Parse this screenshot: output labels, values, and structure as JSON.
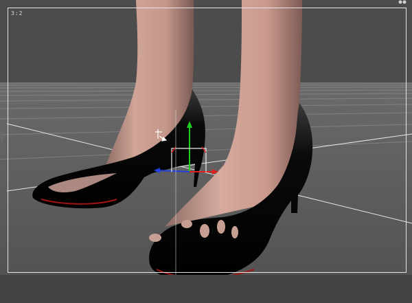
{
  "viewport": {
    "aspect_label": "3:2",
    "frame_color": "#e6e6e6",
    "background_color": "#4c4c4c",
    "floor_color": "#5a5a5a",
    "grid_color": "#9a9a9a"
  },
  "scene": {
    "subject": "legs-with-high-heels",
    "shoe_color": "#050505",
    "sole_accent_color": "#cc1a1a",
    "skin_color": "#c99a8c"
  },
  "gizmo": {
    "x_axis_color": "#e02020",
    "y_axis_color": "#20d020",
    "z_axis_color": "#2040e0"
  },
  "icons": {
    "corner": "view-options-icon",
    "cursor": "transform-cursor-icon"
  }
}
